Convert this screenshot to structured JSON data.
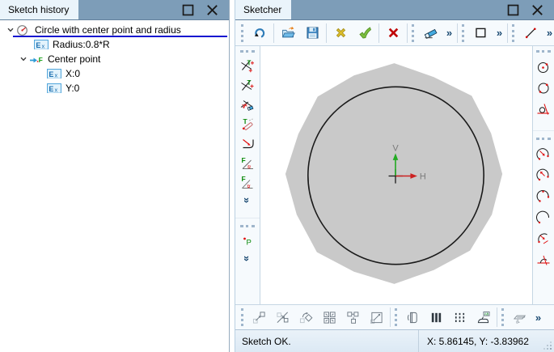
{
  "left_panel": {
    "title": "Sketch history",
    "controls": [
      {
        "icon": "maximize-icon",
        "kind": "win"
      },
      {
        "icon": "close-icon",
        "kind": "win"
      }
    ],
    "tree": [
      {
        "label": "Circle with center point and radius",
        "icon": "circle-radius-icon",
        "chevron": true,
        "indent": 0,
        "selected": true
      },
      {
        "label": "Radius:0.8*R",
        "icon": "expression-icon",
        "chevron": false,
        "indent": 2,
        "selected": false
      },
      {
        "label": "Center point",
        "icon": "fixed-point-icon",
        "chevron": true,
        "indent": 1,
        "selected": false
      },
      {
        "label": "X:0",
        "icon": "expression-icon",
        "chevron": false,
        "indent": 3,
        "selected": false
      },
      {
        "label": "Y:0",
        "icon": "expression-icon",
        "chevron": false,
        "indent": 3,
        "selected": false
      }
    ]
  },
  "sketcher": {
    "title": "Sketcher",
    "controls": [
      {
        "icon": "maximize-icon",
        "kind": "win"
      },
      {
        "icon": "close-icon",
        "kind": "win"
      }
    ],
    "top_toolbar": [
      {
        "type": "handle"
      },
      {
        "icon": "undo-icon"
      },
      {
        "type": "sep"
      },
      {
        "icon": "open-icon"
      },
      {
        "icon": "save-icon"
      },
      {
        "type": "sep"
      },
      {
        "icon": "discard-icon"
      },
      {
        "icon": "accept-icon"
      },
      {
        "type": "sep"
      },
      {
        "icon": "cancel-icon"
      },
      {
        "type": "sep"
      },
      {
        "type": "handle"
      },
      {
        "icon": "eraser-icon"
      },
      {
        "type": "overflow",
        "glyph": "»",
        "name": "erase-tools-overflow-button"
      },
      {
        "type": "sep"
      },
      {
        "type": "handle"
      },
      {
        "icon": "rectangle-tool-icon"
      },
      {
        "type": "overflow",
        "glyph": "»",
        "name": "rectangle-tools-overflow-button"
      },
      {
        "type": "sep"
      },
      {
        "type": "handle"
      },
      {
        "icon": "line-tool-icon"
      },
      {
        "type": "overflow",
        "glyph": "»",
        "name": "line-tools-overflow-button"
      }
    ],
    "left_toolbar": [
      {
        "type": "handle"
      },
      {
        "icon": "split-edge-icon"
      },
      {
        "icon": "split-edge-alt-icon"
      },
      {
        "icon": "erase-segment-icon"
      },
      {
        "icon": "tangent-constraint-icon"
      },
      {
        "icon": "fillet-icon"
      },
      {
        "icon": "fix-angle-icon"
      },
      {
        "icon": "fix-angle-alt-icon"
      },
      {
        "type": "more",
        "glyph": "»",
        "name": "more-edit-tools-button"
      },
      {
        "type": "gap"
      },
      {
        "type": "handle"
      },
      {
        "icon": "fix-point-icon"
      },
      {
        "type": "more",
        "glyph": "»",
        "name": "more-constraint-tools-button"
      }
    ],
    "right_toolbar": [
      {
        "type": "handle"
      },
      {
        "icon": "circle-center-radius-icon"
      },
      {
        "icon": "circle-points-icon"
      },
      {
        "icon": "circle-tangent-icon"
      },
      {
        "type": "gap"
      },
      {
        "type": "handle"
      },
      {
        "icon": "arc-center-icon"
      },
      {
        "icon": "arc-endpoints-icon"
      },
      {
        "icon": "arc-3point-icon"
      },
      {
        "icon": "arc-icon"
      },
      {
        "icon": "arc-tangent-icon"
      },
      {
        "icon": "tangent-arc-line-icon"
      }
    ],
    "bottom_toolbar": [
      {
        "type": "handle"
      },
      {
        "icon": "move-icon",
        "disabled": true
      },
      {
        "icon": "mirror-move-icon",
        "disabled": true
      },
      {
        "icon": "rotate-icon",
        "disabled": true
      },
      {
        "icon": "array-icon",
        "disabled": true
      },
      {
        "icon": "circular-array-icon",
        "disabled": true
      },
      {
        "icon": "scale-icon",
        "disabled": true
      },
      {
        "type": "sep"
      },
      {
        "type": "handle"
      },
      {
        "icon": "unfold-icon"
      },
      {
        "icon": "section-solid-icon"
      },
      {
        "icon": "section-dashed-icon"
      },
      {
        "icon": "stamp-text-icon"
      },
      {
        "type": "sep"
      },
      {
        "type": "handle"
      },
      {
        "icon": "sheet-metal-icon"
      },
      {
        "type": "overflow",
        "glyph": "»",
        "name": "bottom-tools-overflow-button"
      }
    ],
    "canvas": {
      "v_axis_label": "V",
      "h_axis_label": "H"
    },
    "status": {
      "message": "Sketch OK.",
      "coordinates": "X: 5.86145, Y: -3.83962"
    }
  },
  "colors": {
    "titlebar": "#7D9DB8",
    "tab": "#EAF4FB",
    "selection_line": "#1515D0",
    "status_bg": "#DCE9F4",
    "axis_v": "#22AA22",
    "axis_h": "#CC2222",
    "face": "#C9C9C9",
    "accent": "#1B4A72"
  }
}
